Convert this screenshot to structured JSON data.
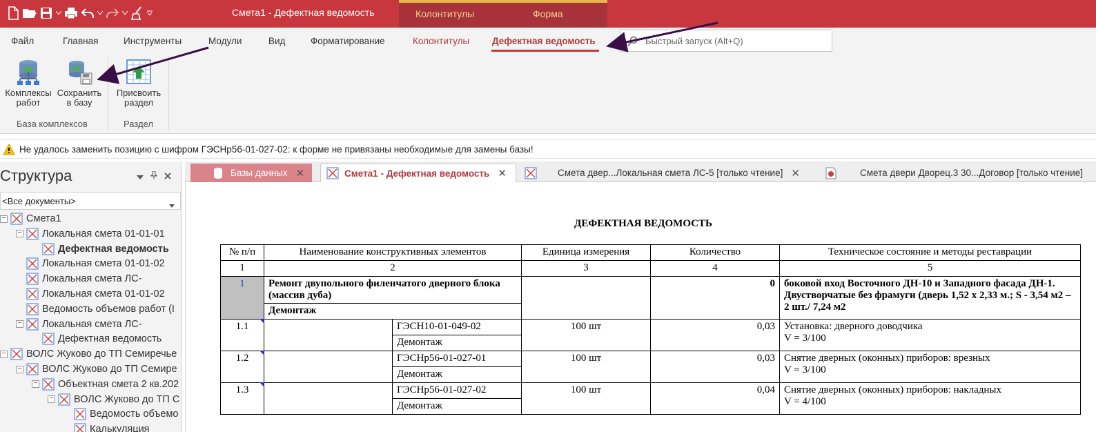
{
  "titlebar": {
    "window_title": "Смета1 - Дефектная ведомость",
    "context_tabs": [
      "Колонтитулы",
      "Форма"
    ],
    "quick_access_icons": [
      "new-file-icon",
      "open-folder-icon",
      "save-icon",
      "print-icon",
      "undo-icon",
      "redo-icon",
      "brush-icon",
      "customize-icon"
    ]
  },
  "ribbon": {
    "tabs": [
      "Файл",
      "Главная",
      "Инструменты",
      "Модули",
      "Вид",
      "Форматирование",
      "Колонтитулы",
      "Дефектная ведомость"
    ],
    "active_tab": "Дефектная ведомость",
    "search_placeholder": "Быстрый запуск (Alt+Q)",
    "buttons": [
      {
        "label_line1": "Комплексы",
        "label_line2": "работ",
        "icon": "database-icon"
      },
      {
        "label_line1": "Сохранить",
        "label_line2": "в базу",
        "icon": "save-to-database-icon"
      },
      {
        "label_line1": "Присвоить",
        "label_line2": "раздел",
        "icon": "assign-section-icon"
      }
    ],
    "groups": [
      "База комплексов",
      "Раздел"
    ]
  },
  "warning": {
    "text": "Не удалось заменить позицию с шифром ГЭСНр56-01-027-02: к форме не привязаны необходимые для замены базы!",
    "icon": "warning-icon"
  },
  "structure": {
    "title": "Структура",
    "filter_value": "<Все документы>",
    "tree": [
      {
        "label": "Смета1",
        "level": 0,
        "expander": "-"
      },
      {
        "label": "Локальная смета 01-01-01",
        "level": 1,
        "expander": "-"
      },
      {
        "label": "Дефектная ведомость",
        "level": 2,
        "expander": "",
        "bold": true
      },
      {
        "label": "Локальная смета 01-01-02",
        "level": 1,
        "expander": ""
      },
      {
        "label": "Локальная смета ЛС-",
        "level": 1,
        "expander": ""
      },
      {
        "label": "Локальная смета 01-01-02",
        "level": 1,
        "expander": ""
      },
      {
        "label": "Ведомость объемов работ (I",
        "level": 1,
        "expander": ""
      },
      {
        "label": "Локальная смета ЛС-",
        "level": 1,
        "expander": "-"
      },
      {
        "label": "Дефектная ведомость",
        "level": 2,
        "expander": ""
      },
      {
        "label": "ВОЛС Жуково до ТП Семиречье",
        "level": 0,
        "expander": "-"
      },
      {
        "label": "ВОЛС Жуково до ТП Семире",
        "level": 1,
        "expander": "-"
      },
      {
        "label": "Объектная смета 2 кв.202",
        "level": 2,
        "expander": "-"
      },
      {
        "label": "ВОЛС Жуково до ТП С",
        "level": 3,
        "expander": "-"
      },
      {
        "label": "Ведомость объемо",
        "level": 4,
        "expander": ""
      },
      {
        "label": "Калькуляция",
        "level": 4,
        "expander": ""
      }
    ]
  },
  "doc_tabs": [
    {
      "label": "Базы данных"
    },
    {
      "label": "Смета1 - Дефектная ведомость",
      "active": true
    },
    {
      "label": "Смета двер...Локальная смета ЛС-5 [только чтение]"
    },
    {
      "label": "Смета двери Дворец.3 30...Договор [только чтение]"
    }
  ],
  "document": {
    "heading": "ДЕФЕКТНАЯ ВЕДОМОСТЬ",
    "columns": [
      "№ п/п",
      "Наименование конструктивных элементов",
      "Единица измерения",
      "Количество",
      "Техническое состояние и методы реставрации"
    ],
    "column_numbers": [
      "1",
      "2",
      "3",
      "4",
      "5"
    ],
    "section": {
      "num": "1",
      "title": "Ремонт двупольного филенчатого дверного блока (массив дуба)",
      "subtitle": "Демонтаж",
      "quantity": "0",
      "state": "боковой вход Восточного ДН-10 и Западного фасада ДН-1. Двустворчатые без фрамуги (дверь 1,52 х 2,33 м.; S - 3,54 м2 – 2 шт./ 7,24 м2"
    },
    "rows": [
      {
        "num": "1.1",
        "code": "ГЭСН10-01-049-02",
        "sub": "Демонтаж",
        "unit": "100 шт",
        "qty": "0,03",
        "state_line1": "Установка: дверного доводчика",
        "state_line2": "V = 3/100"
      },
      {
        "num": "1.2",
        "code": "ГЭСНр56-01-027-01",
        "sub": "Демонтаж",
        "unit": "100 шт",
        "qty": "0,03",
        "state_line1": "Снятие дверных (оконных) приборов: врезных",
        "state_line2": "V = 3/100"
      },
      {
        "num": "1.3",
        "code": "ГЭСНр56-01-027-02",
        "sub": "Демонтаж",
        "unit": "100 шт",
        "qty": "0,04",
        "state_line1": "Снятие дверных (оконных) приборов: накладных",
        "state_line2": "V = 4/100"
      }
    ]
  },
  "colors": {
    "title_bar": "#c8373e",
    "context_group": "#a8323a",
    "context_text": "#f5d38a",
    "accent": "#b03a40",
    "annotation_arrow": "#3a0f47"
  }
}
